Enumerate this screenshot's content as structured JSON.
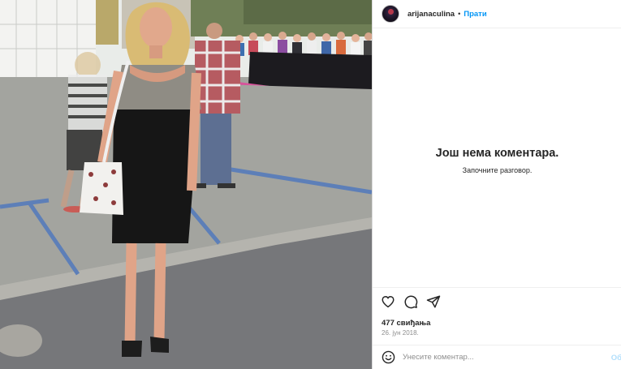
{
  "post": {
    "username": "arijanaculina",
    "separator": "•",
    "follow_label": "Прати",
    "empty_title": "Још нема коментара.",
    "empty_subtitle": "Започните разговор.",
    "likes": "477 свиђања",
    "date": "26. јун 2018.",
    "comment_placeholder": "Унесите коментар...",
    "post_label": "Об"
  },
  "icons": {
    "like": "heart-icon",
    "comment": "comment-icon",
    "share": "paper-plane-icon",
    "emoji": "smiley-icon"
  },
  "colors": {
    "accent": "#0095f6",
    "post_disabled": "#b2dffc",
    "text": "#262626",
    "muted": "#8e8e8e",
    "border": "#dbdbdb"
  }
}
